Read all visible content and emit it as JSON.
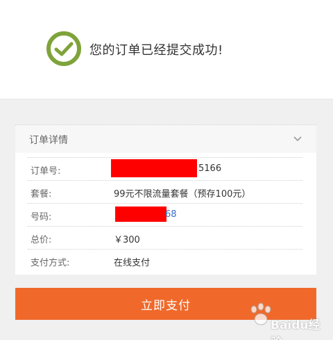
{
  "success": {
    "message": "您的订单已经提交成功!",
    "icon": "check-circle-icon",
    "icon_color": "#7fa33a"
  },
  "order": {
    "section_title": "订单详情",
    "rows": [
      {
        "label": "订单号:",
        "value": "5166"
      },
      {
        "label": "套餐:",
        "value": "99元不限流量套餐（预存100元）"
      },
      {
        "label": "号码:",
        "value": "68"
      },
      {
        "label": "总价:",
        "value": "￥300"
      },
      {
        "label": "支付方式:",
        "value": "在线支付"
      }
    ]
  },
  "pay_button_label": "立即支付",
  "watermark": "Baidu经验",
  "colors": {
    "accent": "#f0692b",
    "redaction": "#ff0000",
    "link": "#3a6fc7"
  }
}
